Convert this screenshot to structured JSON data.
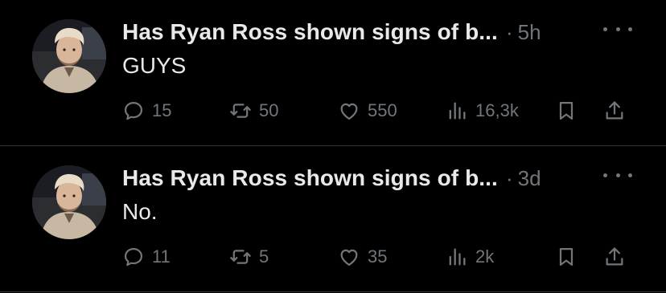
{
  "posts": [
    {
      "title": "Has Ryan Ross shown signs of b...",
      "separator": "·",
      "time": "5h",
      "text": "GUYS",
      "replies": "15",
      "reposts": "50",
      "likes": "550",
      "views": "16,3k"
    },
    {
      "title": "Has Ryan Ross shown signs of b...",
      "separator": "·",
      "time": "3d",
      "text": "No.",
      "replies": "11",
      "reposts": "5",
      "likes": "35",
      "views": "2k"
    }
  ],
  "icons": {
    "reply": "speech-bubble-icon",
    "repost": "repost-arrows-icon",
    "like": "heart-icon",
    "views": "bar-chart-icon",
    "bookmark": "bookmark-icon",
    "share": "share-upload-icon",
    "more": "more-dots-icon"
  },
  "colors": {
    "background": "#000000",
    "primary_text": "#e7e9ea",
    "secondary_text": "#71767b",
    "divider": "#2f3336"
  }
}
